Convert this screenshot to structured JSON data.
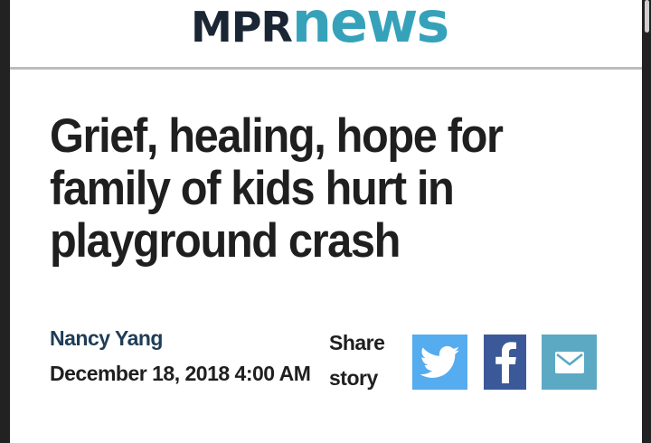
{
  "header": {
    "logo_mpr": "MPR",
    "logo_news": "news"
  },
  "article": {
    "headline": "Grief, healing, hope for family of kids hurt in playground crash",
    "author": "Nancy Yang",
    "date": "December 18, 2018 4:00 AM"
  },
  "share": {
    "label": "Share story",
    "buttons": [
      {
        "icon": "twitter-icon",
        "color": "#55acee"
      },
      {
        "icon": "facebook-icon",
        "color": "#3b5998"
      },
      {
        "icon": "email-icon",
        "color": "#5ca9c4"
      }
    ]
  },
  "colors": {
    "brand_dark": "#1a2633",
    "brand_teal": "#35a2ba",
    "author_link": "#1f3d58"
  }
}
